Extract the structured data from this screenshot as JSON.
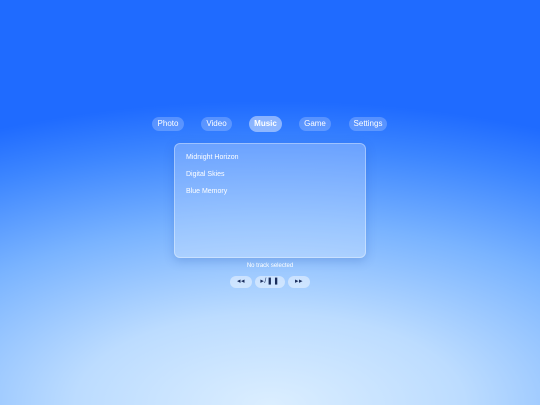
{
  "nav": {
    "tabs": [
      {
        "label": "Photo",
        "active": false
      },
      {
        "label": "Video",
        "active": false
      },
      {
        "label": "Music",
        "active": true
      },
      {
        "label": "Game",
        "active": false
      },
      {
        "label": "Settings",
        "active": false
      }
    ]
  },
  "playlist": {
    "tracks": [
      "Midnight Horizon",
      "Digital Skies",
      "Blue Memory"
    ]
  },
  "player": {
    "status": "No track selected",
    "prev_label": "◂◂",
    "play_pause_label": "▸/❚❚",
    "next_label": "▸▸"
  }
}
